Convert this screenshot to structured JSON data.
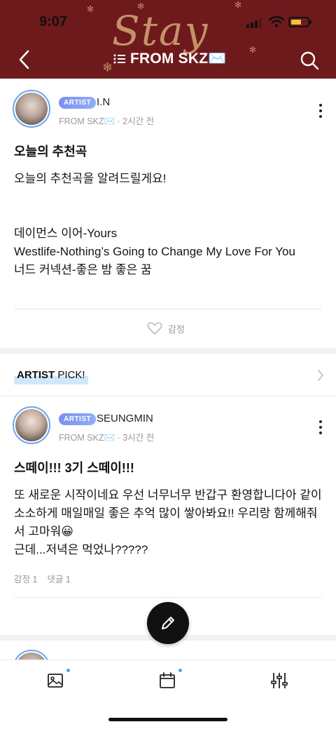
{
  "status_bar": {
    "time": "9:07"
  },
  "header": {
    "title": "FROM SKZ✉️",
    "logo_text": "Stay"
  },
  "posts": [
    {
      "badge": "ARTIST",
      "author": "I.N",
      "meta_source": "FROM SKZ✉️",
      "meta_time": "· 2시간 전",
      "title": "오늘의 추천곡",
      "body": [
        "오늘의 추천곡을 알려드릴게요!",
        "",
        "",
        "데이먼스 이어-Yours",
        "Westlife-Nothing’s Going to Change My Love For You",
        "너드 커넥션-좋은 밤 좋은 꿈"
      ],
      "like_label": "감정"
    },
    {
      "badge": "ARTIST",
      "author": "SEUNGMIN",
      "meta_source": "FROM SKZ✉️",
      "meta_time": "· 3시간 전",
      "title": "스떼이!!! 3기 스떼이!!!",
      "body": [
        "또 새로운 시작이네요 우선 너무너무 반갑구 환영합니다아 같이 소소하게 매일매일 좋은 추억 많이 쌓아봐요!! 우리랑 함께해줘서 고마워😀",
        "근데...저녁은 먹었나?????"
      ],
      "reactions": "감정 1",
      "comments": "댓글 1"
    }
  ],
  "artist_pick": {
    "bold": "ARTIST",
    "rest": " PICK!"
  },
  "bottom_nav": [
    {
      "name": "photo",
      "icon": "image-icon",
      "has_dot": true
    },
    {
      "name": "calendar",
      "icon": "calendar-icon",
      "has_dot": true
    },
    {
      "name": "settings",
      "icon": "sliders-icon",
      "has_dot": false
    }
  ],
  "colors": {
    "header_bg": "#6e1a1c",
    "logo_gold": "#d3a778",
    "badge_blue": "#7a8ff2",
    "pick_highlight": "#cfe9fb",
    "dot_blue": "#4aa3f5"
  }
}
